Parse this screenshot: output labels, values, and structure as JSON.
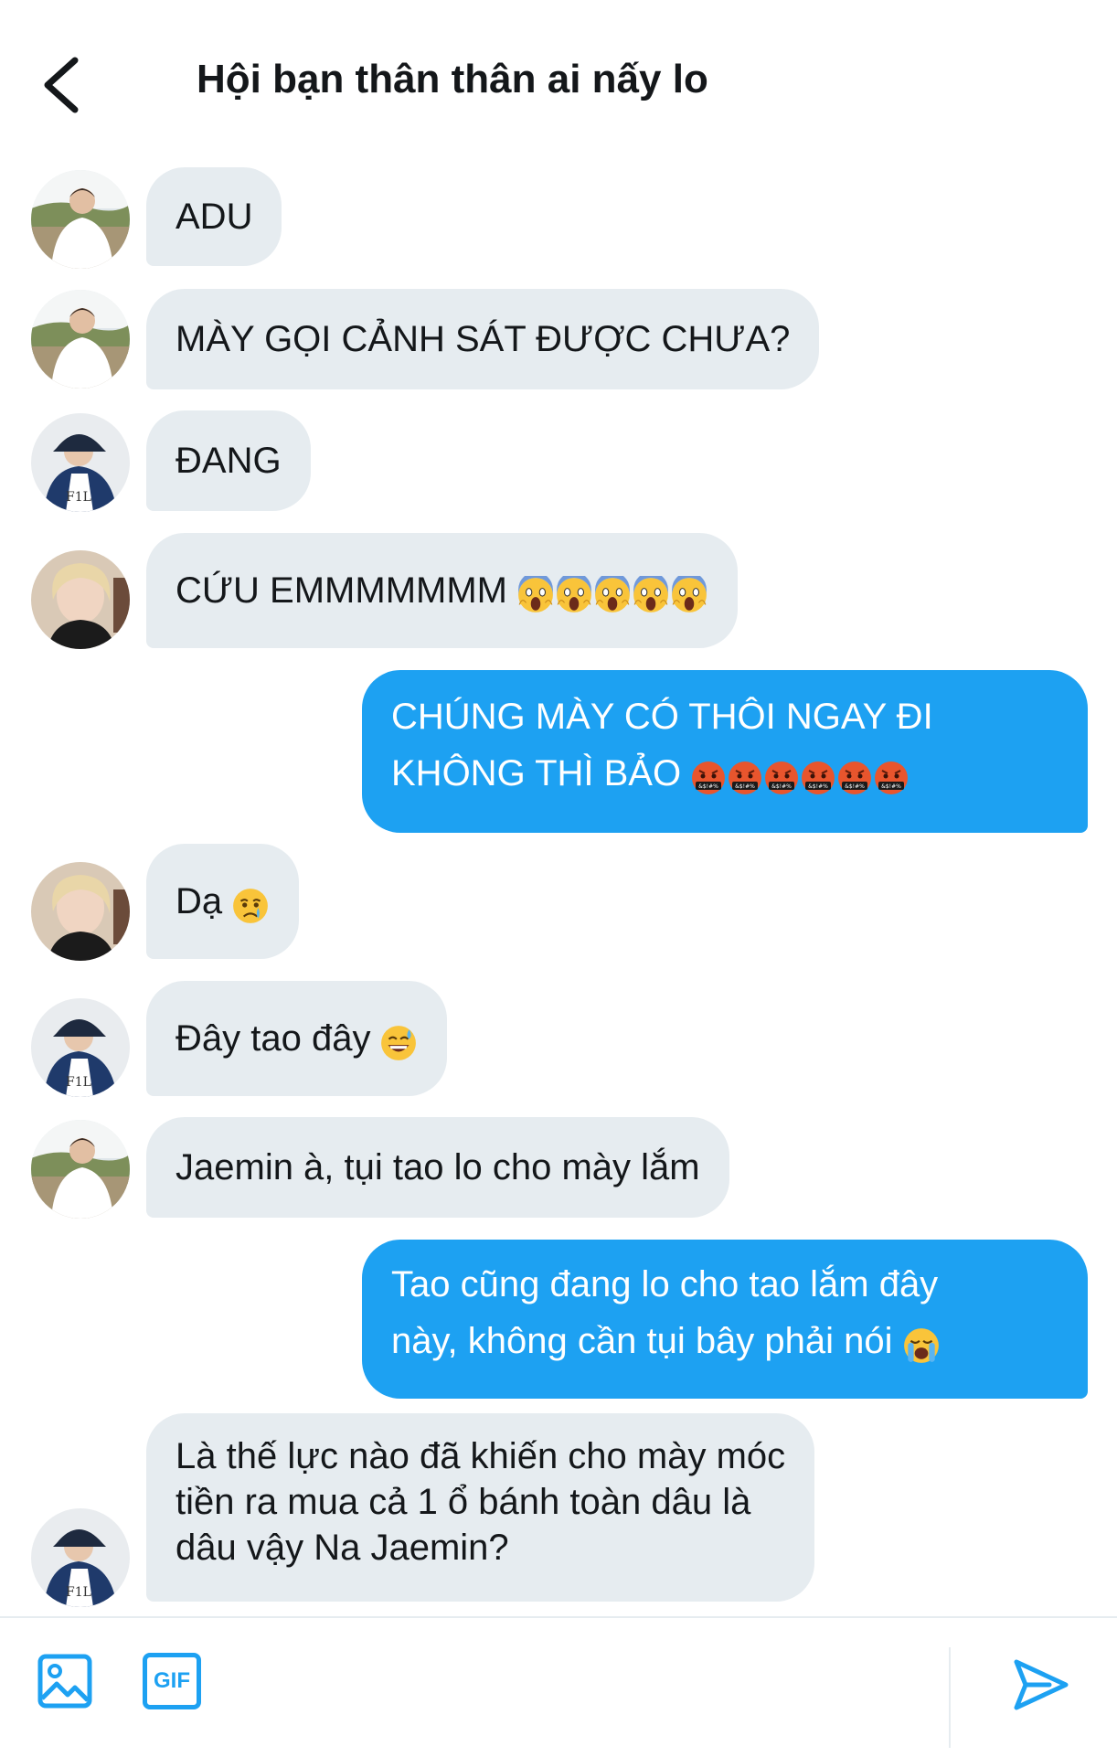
{
  "header": {
    "title": "Hội bạn thân thân ai nấy lo",
    "back_icon": "chevron-left-icon"
  },
  "colors": {
    "incoming_bubble": "#e6ecf0",
    "outgoing_bubble": "#1da1f2",
    "accent": "#1da1f2"
  },
  "messages": [
    {
      "sender": "incoming",
      "avatar": "avatar-white-shirt",
      "lines": [
        "ADU"
      ]
    },
    {
      "sender": "incoming",
      "avatar": "avatar-white-shirt",
      "lines": [
        "MÀY GỌI CẢNH SÁT ĐƯỢC CHƯA?"
      ]
    },
    {
      "sender": "incoming",
      "avatar": "avatar-bucket-hat",
      "lines": [
        "ĐANG"
      ]
    },
    {
      "sender": "incoming",
      "avatar": "avatar-blonde",
      "lines": [
        "CỨU EMMMMMMM"
      ],
      "emoji": [
        "screaming-face",
        "screaming-face",
        "screaming-face",
        "screaming-face",
        "screaming-face"
      ]
    },
    {
      "sender": "outgoing",
      "lines": [
        "CHÚNG MÀY CÓ THÔI NGAY ĐI",
        "KHÔNG THÌ BẢO"
      ],
      "emoji": [
        "cursing-face",
        "cursing-face",
        "cursing-face",
        "cursing-face",
        "cursing-face",
        "cursing-face"
      ]
    },
    {
      "sender": "incoming",
      "avatar": "avatar-blonde",
      "lines": [
        "Dạ"
      ],
      "emoji": [
        "crying-face"
      ]
    },
    {
      "sender": "incoming",
      "avatar": "avatar-bucket-hat",
      "lines": [
        "Đây tao đây"
      ],
      "emoji": [
        "grinning-sweat-face"
      ]
    },
    {
      "sender": "incoming",
      "avatar": "avatar-white-shirt",
      "lines": [
        "Jaemin à, tụi tao lo cho mày lắm"
      ]
    },
    {
      "sender": "outgoing",
      "lines": [
        "Tao cũng đang lo cho tao lắm đây",
        "này, không cần tụi bây phải nói"
      ],
      "emoji": [
        "loudly-crying-face"
      ]
    },
    {
      "sender": "incoming",
      "avatar": "avatar-bucket-hat",
      "lines": [
        "Là thế lực nào đã khiến cho mày móc",
        "tiền ra mua cả 1 ổ bánh toàn dâu là",
        "dâu vậy Na Jaemin?"
      ]
    }
  ],
  "composer": {
    "image_icon": "image-icon",
    "gif_label": "GIF",
    "send_icon": "send-icon"
  }
}
